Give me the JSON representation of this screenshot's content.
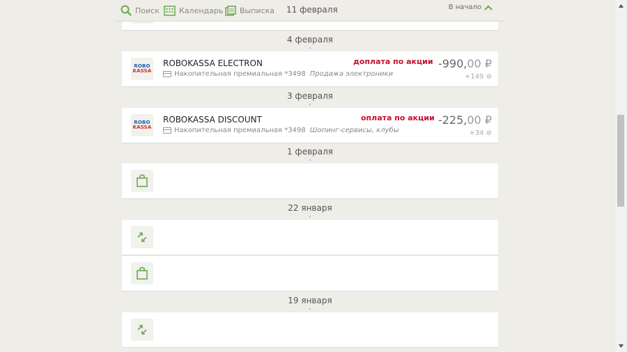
{
  "toolbar": {
    "search_label": "Поиск",
    "calendar_label": "Календарь",
    "statement_label": "Выписка",
    "current_date": "11 февраля",
    "to_top_label": "В начало"
  },
  "colors": {
    "accent": "#6aa84f",
    "promo": "#c8102e"
  },
  "dates": [
    "4 февраля",
    "3 февраля",
    "1 февраля",
    "22 января",
    "19 января"
  ],
  "transactions": [
    {
      "merchant": "ROBOKASSA ELECTRON",
      "logo_line1": "ROBO",
      "logo_line2": "KASSA",
      "card": "Накопительная премиальная *3498",
      "category": "Продажа электроники",
      "promo": "доплата по акции",
      "amount_int": "-990,",
      "amount_dec": "00 ₽",
      "bonus": "+149"
    },
    {
      "merchant": "ROBOKASSA DISCOUNT",
      "logo_line1": "ROBO",
      "logo_line2": "KASSA",
      "card": "Накопительная премиальная *3498",
      "category": "Шопинг-сервисы, клубы",
      "promo": "оплата по акции",
      "amount_int": "-225,",
      "amount_dec": "00 ₽",
      "bonus": "+34"
    }
  ],
  "icons": [
    "search-icon",
    "calendar-icon",
    "statement-icon",
    "chevron-up-icon",
    "shopping-bag-icon",
    "transfer-arrows-icon"
  ]
}
